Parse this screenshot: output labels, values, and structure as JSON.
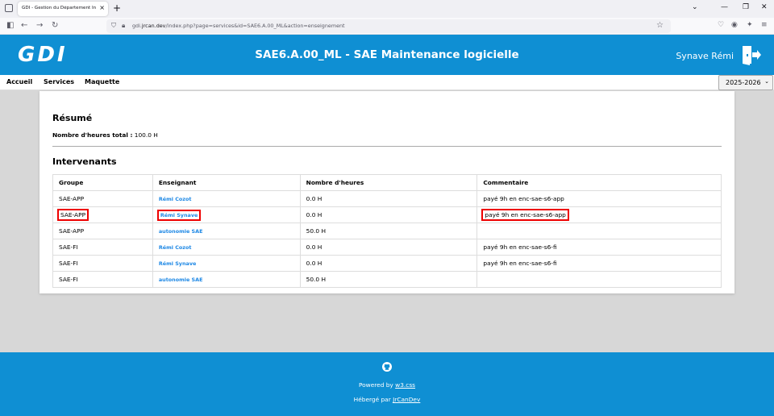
{
  "browser": {
    "tab_title": "GDI - Gestion du Département Info",
    "tab_close": "×",
    "new_tab": "+",
    "url_prefix": "gdi.",
    "url_domain": "jrcan.dev",
    "url_rest": "/index.php?page=services&id=SAE6.A.00_ML&action=enseignement"
  },
  "header": {
    "logo": "GDI",
    "title": "SAE6.A.00_ML - SAE Maintenance logicielle",
    "user": "Synave Rémi"
  },
  "nav": {
    "items": [
      "Accueil",
      "Services",
      "Maquette"
    ],
    "year": "2025-2026"
  },
  "summary": {
    "heading": "Résumé",
    "total_label": "Nombre d'heures total :",
    "total_value": "100.0 H"
  },
  "intervenants": {
    "heading": "Intervenants",
    "columns": [
      "Groupe",
      "Enseignant",
      "Nombre d'heures",
      "Commentaire"
    ],
    "rows": [
      {
        "groupe": "SAE-APP",
        "enseignant": "Rémi Cozot",
        "heures": "0.0 H",
        "commentaire": "payé 9h en enc-sae-s6-app"
      },
      {
        "groupe": "SAE-APP",
        "enseignant": "Rémi Synave",
        "heures": "0.0 H",
        "commentaire": "payé 9h en enc-sae-s6-app"
      },
      {
        "groupe": "SAE-APP",
        "enseignant": "autonomie SAE",
        "heures": "50.0 H",
        "commentaire": ""
      },
      {
        "groupe": "SAE-FI",
        "enseignant": "Rémi Cozot",
        "heures": "0.0 H",
        "commentaire": "payé 9h en enc-sae-s6-fi"
      },
      {
        "groupe": "SAE-FI",
        "enseignant": "Rémi Synave",
        "heures": "0.0 H",
        "commentaire": "payé 9h en enc-sae-s6-fi"
      },
      {
        "groupe": "SAE-FI",
        "enseignant": "autonomie SAE",
        "heures": "50.0 H",
        "commentaire": ""
      }
    ]
  },
  "footer": {
    "powered_prefix": "Powered by ",
    "powered_link": "w3.css",
    "hosted_prefix": "Hébergé par ",
    "hosted_link": "JrCanDev"
  },
  "colors": {
    "brand": "#0f8fd3",
    "link": "#1e88e5",
    "highlight": "#e00000"
  }
}
